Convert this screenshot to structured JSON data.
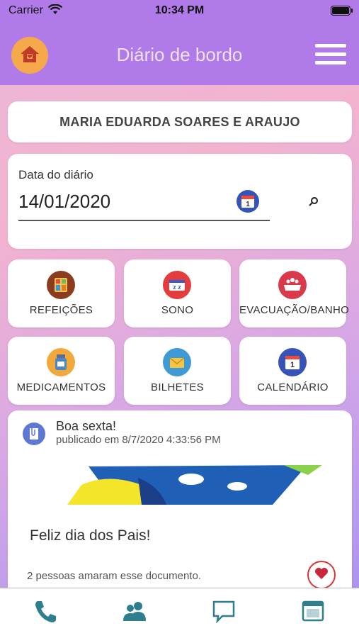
{
  "status_bar": {
    "carrier": "Carrier",
    "time": "10:34 PM"
  },
  "header": {
    "title": "Diário de bordo"
  },
  "student": {
    "name": "MARIA EDUARDA SOARES E ARAUJO"
  },
  "diary_date": {
    "label": "Data do diário",
    "value": "14/01/2020"
  },
  "tiles": [
    {
      "label": "REFEIÇÕES",
      "icon": "meals-icon"
    },
    {
      "label": "SONO",
      "icon": "sleep-icon"
    },
    {
      "label": "EVACUAÇÃO/BANHO",
      "icon": "bath-icon"
    },
    {
      "label": "MEDICAMENTOS",
      "icon": "medicine-icon"
    },
    {
      "label": "BILHETES",
      "icon": "mail-icon"
    },
    {
      "label": "CALENDÁRIO",
      "icon": "calendar-icon"
    }
  ],
  "post": {
    "title": "Boa sexta!",
    "published": "publicado em 8/7/2020 4:33:56 PM",
    "text": "Feliz dia dos Pais!",
    "likes": "2 pessoas amaram esse documento."
  },
  "calendar_icon_day": "1",
  "tabs": [
    {
      "name": "phone-icon"
    },
    {
      "name": "contacts-icon"
    },
    {
      "name": "chat-icon"
    },
    {
      "name": "browser-icon"
    }
  ],
  "colors": {
    "header": "#b07be9",
    "accent_teal": "#2d7f8e",
    "heart": "#cc2233"
  }
}
